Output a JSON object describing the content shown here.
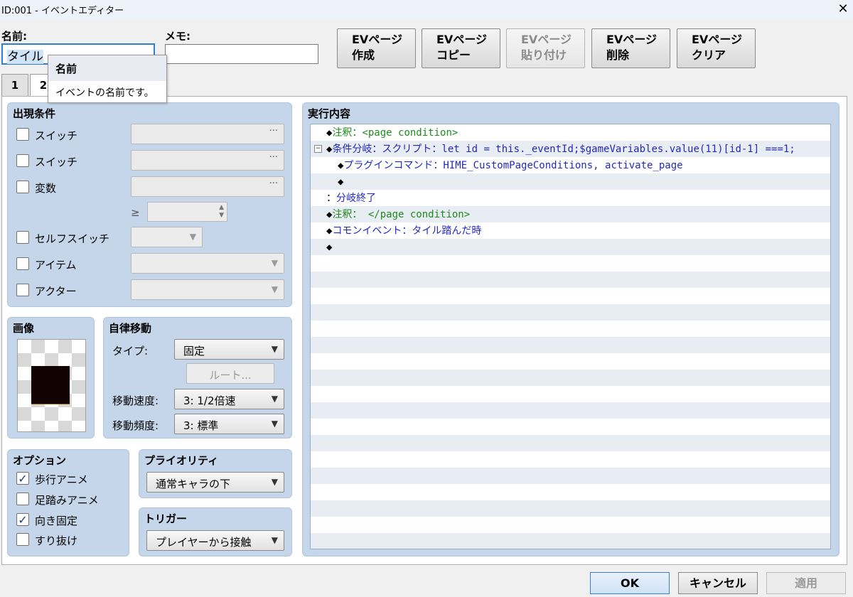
{
  "window": {
    "title": "ID:001 - イベントエディター",
    "close_label": "✕"
  },
  "name_label": "名前:",
  "name_value": "タイル",
  "memo_label": "メモ:",
  "memo_value": "",
  "toolbar": {
    "create": [
      "EVページ",
      "作成"
    ],
    "copy": [
      "EVページ",
      "コピー"
    ],
    "paste": [
      "EVページ",
      "貼り付け"
    ],
    "delete": [
      "EVページ",
      "削除"
    ],
    "clear": [
      "EVページ",
      "クリア"
    ]
  },
  "tabs": [
    "1",
    "2"
  ],
  "tooltip": {
    "title": "名前",
    "text": "イベントの名前です。"
  },
  "conditions": {
    "title": "出現条件",
    "items": [
      {
        "label": "スイッチ",
        "checked": false
      },
      {
        "label": "スイッチ",
        "checked": false
      },
      {
        "label": "変数",
        "checked": false
      },
      {
        "label": "セルフスイッチ",
        "checked": false
      },
      {
        "label": "アイテム",
        "checked": false
      },
      {
        "label": "アクター",
        "checked": false
      }
    ],
    "field_dots": "···",
    "gte": "≥"
  },
  "image": {
    "title": "画像"
  },
  "autonomous": {
    "title": "自律移動",
    "type_label": "タイプ:",
    "type_value": "固定",
    "route_label": "ルート...",
    "speed_label": "移動速度:",
    "speed_value": "3: 1/2倍速",
    "freq_label": "移動頻度:",
    "freq_value": "3: 標準"
  },
  "options": {
    "title": "オプション",
    "items": [
      {
        "label": "歩行アニメ",
        "checked": true
      },
      {
        "label": "足踏みアニメ",
        "checked": false
      },
      {
        "label": "向き固定",
        "checked": true
      },
      {
        "label": "すり抜け",
        "checked": false
      }
    ],
    "check_glyph": "✓"
  },
  "priority": {
    "title": "プライオリティ",
    "value": "通常キャラの下"
  },
  "trigger": {
    "title": "トリガー",
    "value": "プレイヤーから接触"
  },
  "contents": {
    "title": "実行内容",
    "lines": [
      {
        "indent": 0,
        "parts": [
          {
            "t": "◆",
            "c": "dk"
          },
          {
            "t": "注釈：",
            "c": "green"
          },
          {
            "t": "<page condition>",
            "c": "green"
          }
        ]
      },
      {
        "indent": 0,
        "collapse": true,
        "parts": [
          {
            "t": "◆",
            "c": "dk"
          },
          {
            "t": "条件分岐：スクリプト：let id = this._eventId;$gameVariables.value(11)[id-1] ===1;",
            "c": "blue"
          }
        ]
      },
      {
        "indent": 1,
        "parts": [
          {
            "t": "◆",
            "c": "dk"
          },
          {
            "t": "プラグインコマンド：HIME_CustomPageConditions, activate_page",
            "c": "blue"
          }
        ]
      },
      {
        "indent": 1,
        "parts": [
          {
            "t": "◆",
            "c": "dk"
          }
        ]
      },
      {
        "indent": 0,
        "parts": [
          {
            "t": "：",
            "c": "dk"
          },
          {
            "t": "分岐終了",
            "c": "blue"
          }
        ]
      },
      {
        "indent": 0,
        "parts": [
          {
            "t": "◆",
            "c": "dk"
          },
          {
            "t": "注釈： </page condition>",
            "c": "green"
          }
        ]
      },
      {
        "indent": 0,
        "parts": [
          {
            "t": "◆",
            "c": "dk"
          },
          {
            "t": "コモンイベント：タイル踏んだ時",
            "c": "blue"
          }
        ]
      },
      {
        "indent": 0,
        "parts": [
          {
            "t": "◆",
            "c": "dk"
          }
        ]
      }
    ]
  },
  "footer": {
    "ok": "OK",
    "cancel": "キャンセル",
    "apply": "適用"
  },
  "colors": {
    "panel": "#c5d6ea",
    "title_bar": "#eef3fb",
    "accent": "#2f7fd6",
    "comment": "#1e8a1e",
    "command": "#2228c4"
  }
}
